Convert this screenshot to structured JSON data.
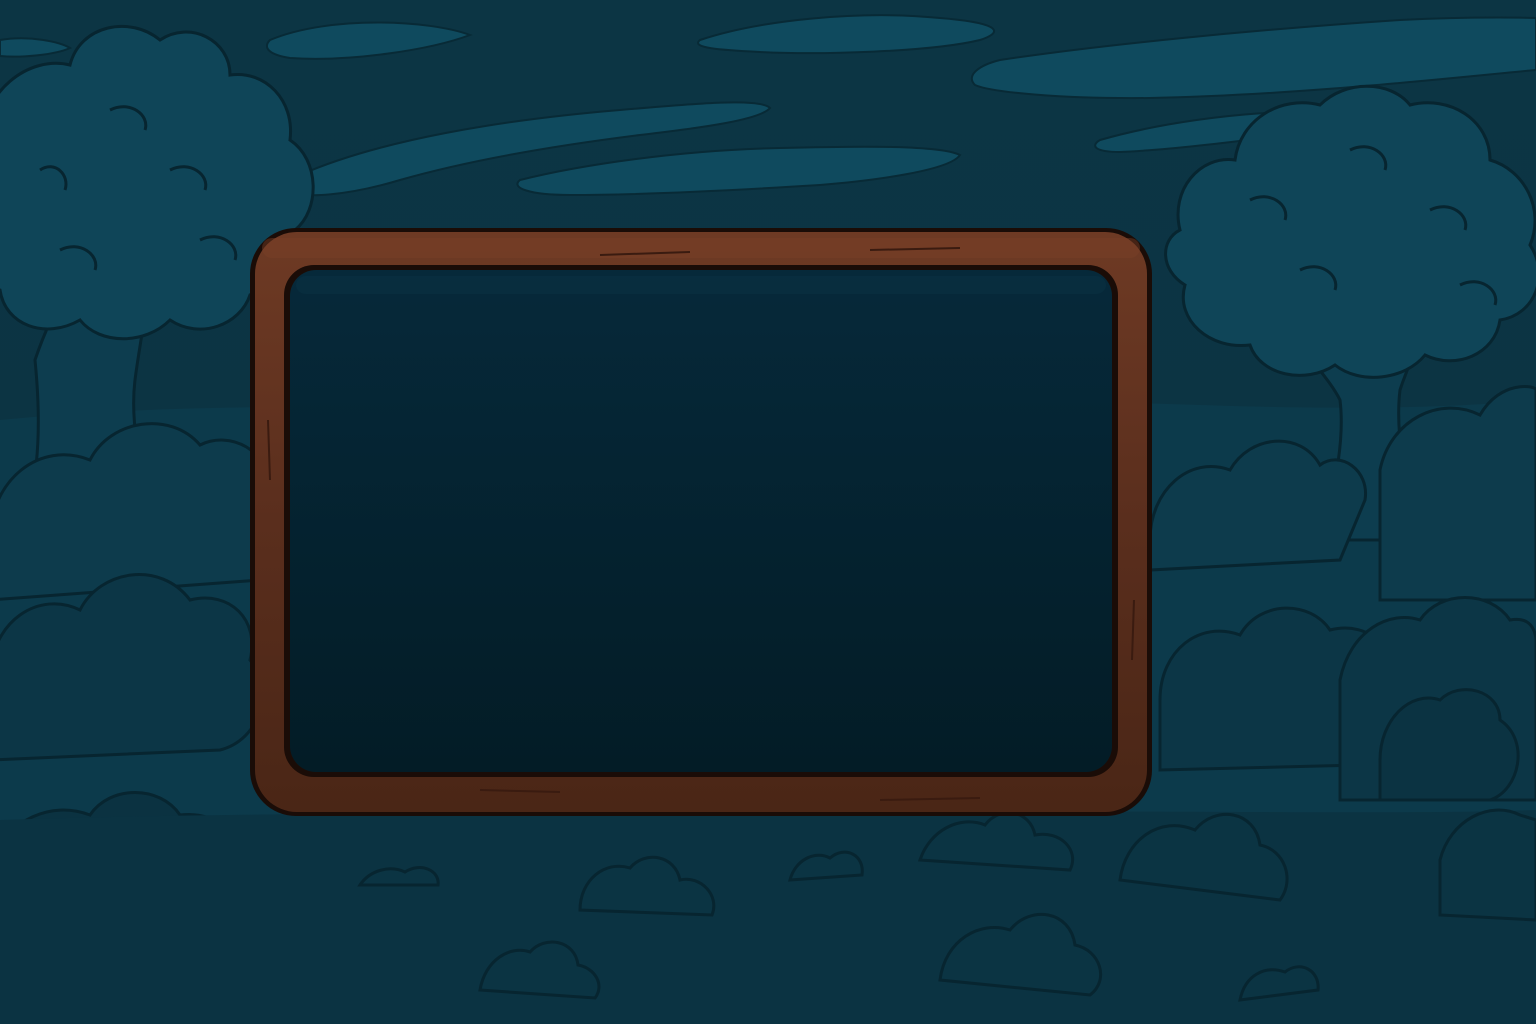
{
  "scene": {
    "type": "empty dialog panel over night forest background"
  },
  "colors": {
    "sky_dark": "#0b2f3c",
    "sky_band": "#0e4456",
    "cloud": "#115066",
    "forest_far": "#0f4052",
    "forest_mid": "#0c3748",
    "forest_near": "#0a3140",
    "outline": "#072530",
    "frame_wood": "#5a2e1d",
    "frame_wood_light": "#6e3a24",
    "frame_wood_dark": "#3a1b10",
    "frame_outline": "#1a0c07",
    "panel_fill": "#04202b"
  },
  "panel": {
    "content_text": ""
  }
}
